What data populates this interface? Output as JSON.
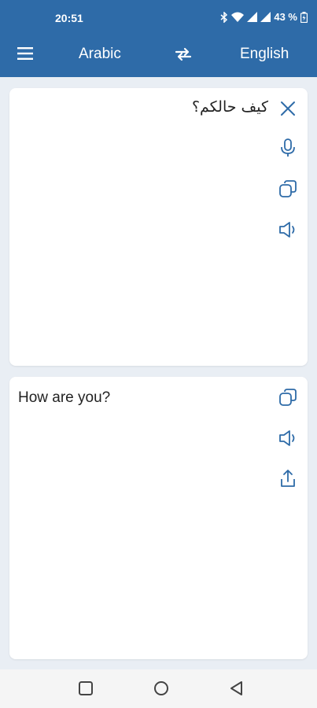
{
  "status": {
    "time": "20:51",
    "battery": "43 %"
  },
  "appbar": {
    "source_language": "Arabic",
    "target_language": "English"
  },
  "input": {
    "text": "كيف حالكم؟"
  },
  "output": {
    "text": "How are you?"
  },
  "colors": {
    "primary": "#2e6ba8",
    "icon": "#2e6ba8",
    "background": "#e9eef4"
  },
  "icons": [
    "menu-icon",
    "swap-icon",
    "close-icon",
    "microphone-icon",
    "copy-icon",
    "speaker-icon",
    "share-icon"
  ]
}
